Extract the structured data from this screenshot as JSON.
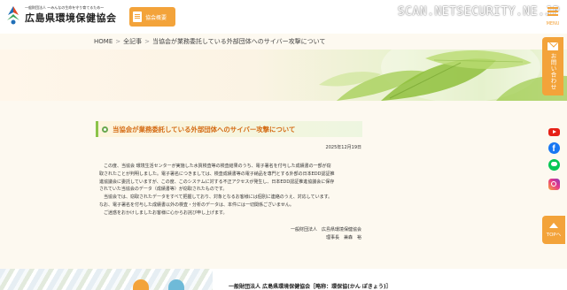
{
  "header": {
    "logo_tagline": "一般財団法人 〜みんなの生命を守り育てるため〜",
    "logo_name": "広島県環境保健協会",
    "nav_button": "協会概要",
    "watermark": "SCAN.NETSECURITY.NE.JP",
    "menu_label": "MENU",
    "accent_color": "#f3a33a"
  },
  "breadcrumb": {
    "items": [
      "HOME",
      "全記事",
      "当協会が業務委託している外部団体へのサイバー攻撃について"
    ],
    "separator": ">"
  },
  "article": {
    "title": "当協会が業務委託している外部団体へのサイバー攻撃について",
    "date": "2025年12月19日",
    "paragraphs": [
      "　この度、当協会 環境生活センターが実施した水質検査等の検査結果のうち、電子署名を付与した成績書の一部が窃",
      "取されたことが判明しました。電子署名につきましては、検査成績書等の電子納品を専門とする外部の日本EDD認証推",
      "進協議会に委託していますが、この度、このシステムに対する不正アクセスが発生し、日本EDD認証推進協議会に保存",
      "されていた当協会のデータ（成績書等）が窃取されたものです。",
      "　当協会では、窃取されたデータをすべて把握しており、対象となるお客様には個別に連絡のうえ、対応しています。",
      "なお、電子署名を付与した成績書以外の検査・分析のデータは、本件には一切関係ございません。",
      "　ご迷惑をおかけしましたお客様に心からお詫び申し上げます。"
    ],
    "signature_org": "一般財団法人　広島県環境保健協会",
    "signature_person": "理事長　兼森　裕"
  },
  "footer": {
    "org_line": "一般財団法人 広島県環境保健協会［略称：環保協(かん ぽきょう)］"
  },
  "sidebar": {
    "contact_label": "お問い合わせ",
    "sns": [
      "youtube-icon",
      "facebook-icon",
      "line-icon",
      "instagram-icon"
    ],
    "to_top_label": "TOPへ"
  }
}
